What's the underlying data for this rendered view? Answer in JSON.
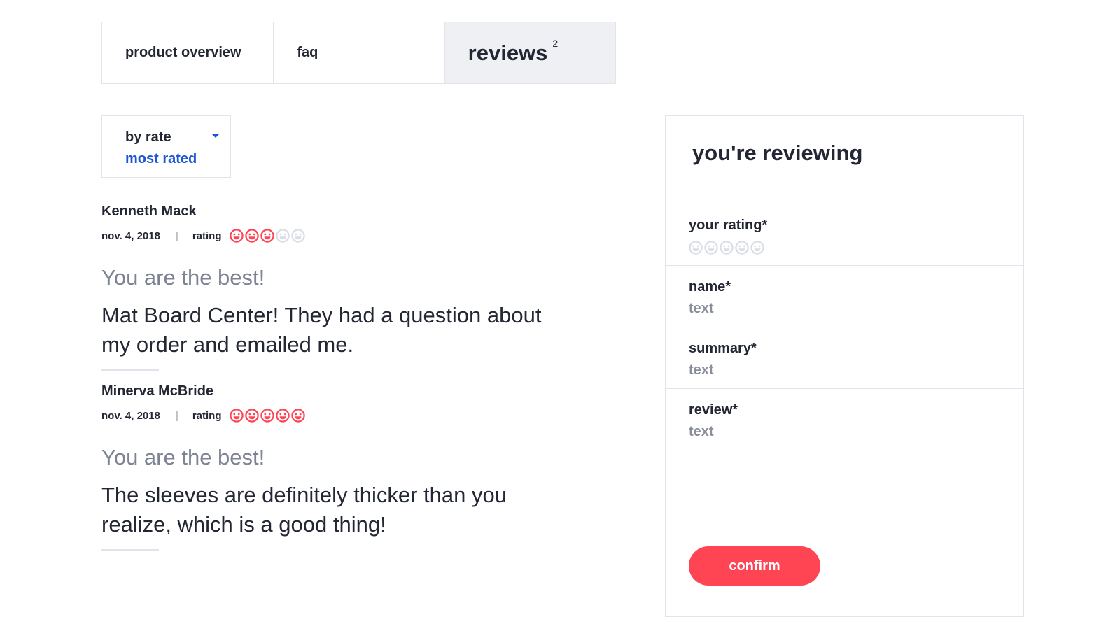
{
  "tabs": [
    {
      "label": "product overview",
      "active": false
    },
    {
      "label": "faq",
      "active": false
    },
    {
      "label": "reviews",
      "count": "2",
      "active": true
    }
  ],
  "sort": {
    "label": "by rate",
    "value": "most rated"
  },
  "reviews": [
    {
      "author": "Kenneth Mack",
      "date": "nov. 4, 2018",
      "separator": "|",
      "rating_label": "rating",
      "rating": 3,
      "rating_max": 5,
      "summary": "You are the best!",
      "body": "Mat Board Center! They had a question about my order and emailed me."
    },
    {
      "author": "Minerva McBride",
      "date": "nov. 4, 2018",
      "separator": "|",
      "rating_label": "rating",
      "rating": 5,
      "rating_max": 5,
      "summary": "You are the best!",
      "body": "The sleeves are definitely thicker than you realize, which is a good thing!"
    }
  ],
  "form": {
    "title": "you're reviewing",
    "rating_label": "your rating*",
    "rating": 0,
    "rating_max": 5,
    "name_label": "name*",
    "name_placeholder": "text",
    "summary_label": "summary*",
    "summary_placeholder": "text",
    "review_label": "review*",
    "review_placeholder": "text",
    "confirm_label": "confirm"
  },
  "colors": {
    "accent": "#ff4454",
    "link": "#1d55d6",
    "face_filled": "#ff4454",
    "face_empty": "#d9dde5",
    "border": "#e1e4ea",
    "active_tab_bg": "#eef0f3"
  },
  "icons": {
    "rating_face": "smiley-face-icon",
    "sort_caret": "caret-down-icon"
  }
}
